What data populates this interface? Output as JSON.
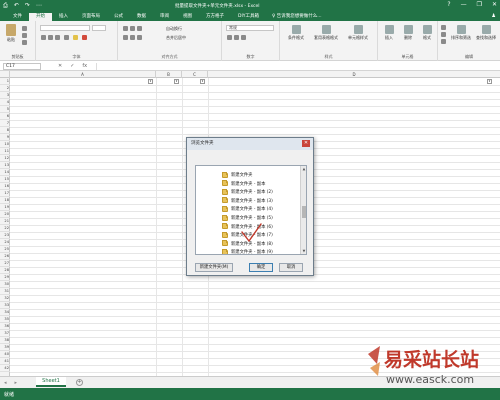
{
  "window": {
    "title": "批量提取文件夹+单元文件夹.xlsx - Excel",
    "qat": [
      "⎙",
      "↶",
      "↷",
      "⋯"
    ],
    "controls": [
      "?",
      "—",
      "❐",
      "✕"
    ]
  },
  "tabs": {
    "items": [
      "文件",
      "开始",
      "插入",
      "页面布局",
      "公式",
      "数据",
      "审阅",
      "视图",
      "方方格子",
      "DIY工具箱"
    ],
    "active": "开始",
    "tellme": "♀ 告诉我您想要做什么...",
    "share": "♟"
  },
  "ribbon": {
    "groups": [
      "剪贴板",
      "字体",
      "对齐方式",
      "数字",
      "样式",
      "单元格",
      "编辑"
    ],
    "paste_label": "粘贴",
    "wrap_label": "自动换行",
    "merge_label": "合并后居中",
    "number_format": "常规",
    "cond_format": "条件格式",
    "table_format": "套用表格格式",
    "cell_style": "单元格样式",
    "insert": "插入",
    "delete": "删除",
    "format": "格式",
    "sort_filter": "排序和筛选",
    "find_select": "查找和选择"
  },
  "formula_bar": {
    "name_box": "C17",
    "cancel": "✕",
    "enter": "✓",
    "fx": "fx",
    "value": ""
  },
  "grid": {
    "columns": [
      "A",
      "B",
      "C",
      "D"
    ],
    "rows": [
      "1",
      "2",
      "3",
      "4",
      "5",
      "6",
      "7",
      "8",
      "9",
      "10",
      "11",
      "12",
      "13",
      "14",
      "15",
      "16",
      "17",
      "18",
      "19",
      "20",
      "21",
      "22",
      "23",
      "24",
      "25",
      "26",
      "27",
      "28",
      "29",
      "30",
      "31",
      "32",
      "33",
      "34",
      "35",
      "36",
      "37",
      "38",
      "39",
      "40",
      "41",
      "42"
    ],
    "filter_glyph": "▾"
  },
  "dialog": {
    "title": "浏览文件夹",
    "close": "✕",
    "folders": [
      "新建文件夹",
      "新建文件夹 - 副本",
      "新建文件夹 - 副本 (2)",
      "新建文件夹 - 副本 (3)",
      "新建文件夹 - 副本 (4)",
      "新建文件夹 - 副本 (5)",
      "新建文件夹 - 副本 (6)",
      "新建文件夹 - 副本 (7)",
      "新建文件夹 - 副本 (8)",
      "新建文件夹 - 副本 (9)"
    ],
    "new_folder_button": "新建文件夹(M)",
    "ok_button": "确定",
    "cancel_button": "取消"
  },
  "sheets": {
    "tab": "Sheet1",
    "add": "+",
    "nav": [
      "◂",
      "▸"
    ]
  },
  "status": {
    "ready": "就绪"
  },
  "watermark": {
    "site_name": "易采站长站",
    "url": "www.easck.com"
  },
  "colors": {
    "excel_green": "#217346",
    "watermark_red": "#c0392b"
  }
}
